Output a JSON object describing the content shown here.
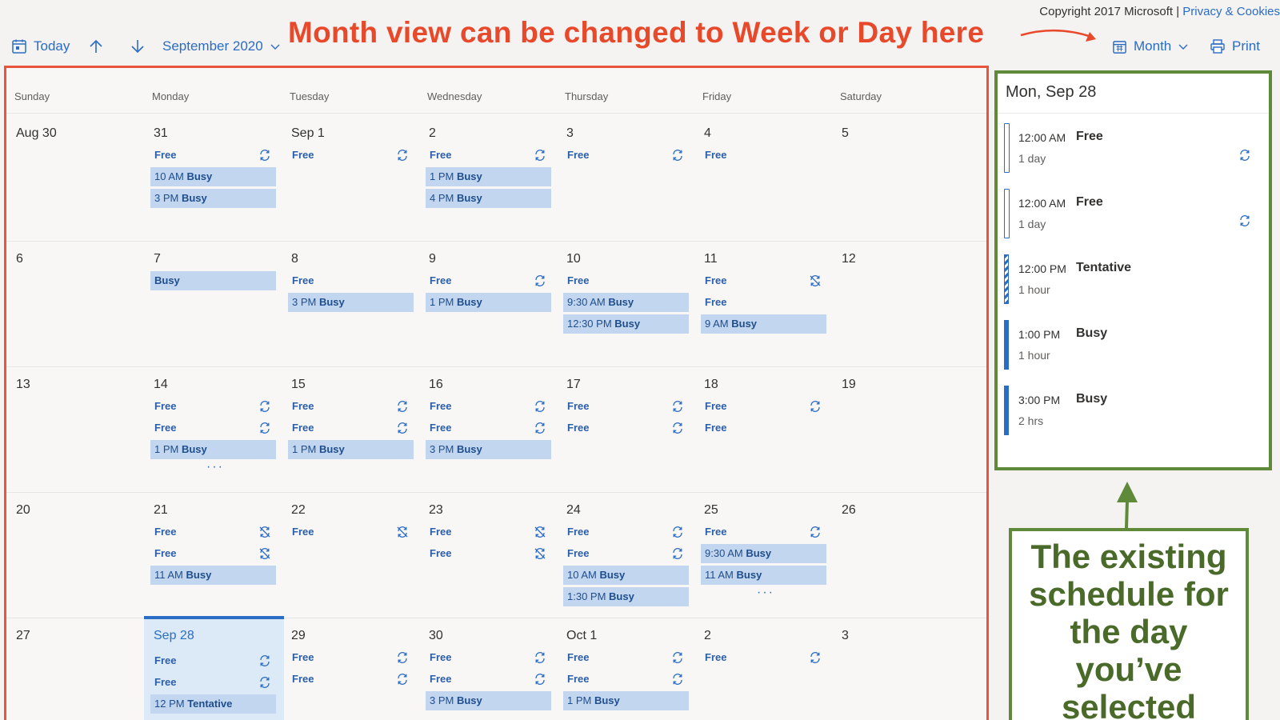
{
  "header": {
    "copyright": "Copyright 2017 Microsoft",
    "separator": "|",
    "privacy_link": "Privacy & Cookies"
  },
  "toolbar": {
    "today": "Today",
    "month_range": "September 2020",
    "view": "Month",
    "print": "Print"
  },
  "annotations": {
    "top": "Month view can be changed to Week or Day here",
    "side_lines": [
      "The existing",
      "schedule for",
      "the day",
      "you’ve",
      "selected"
    ],
    "red_color": "#e8492a",
    "green_color": "#5e8a3a"
  },
  "calendar": {
    "day_names": [
      "Sunday",
      "Monday",
      "Tuesday",
      "Wednesday",
      "Thursday",
      "Friday",
      "Saturday"
    ],
    "weeks": [
      [
        {
          "date": "Aug 30",
          "events": []
        },
        {
          "date": "31",
          "events": [
            {
              "status": "Free",
              "icon": "sync-icon"
            },
            {
              "time": "10 AM",
              "status": "Busy"
            },
            {
              "time": "3 PM",
              "status": "Busy"
            }
          ]
        },
        {
          "date": "Sep 1",
          "events": [
            {
              "status": "Free",
              "icon": "sync-icon"
            }
          ]
        },
        {
          "date": "2",
          "events": [
            {
              "status": "Free",
              "icon": "sync-icon"
            },
            {
              "time": "1 PM",
              "status": "Busy"
            },
            {
              "time": "4 PM",
              "status": "Busy"
            }
          ]
        },
        {
          "date": "3",
          "events": [
            {
              "status": "Free",
              "icon": "sync-icon"
            }
          ]
        },
        {
          "date": "4",
          "events": [
            {
              "status": "Free"
            }
          ]
        },
        {
          "date": "5",
          "events": []
        }
      ],
      [
        {
          "date": "6",
          "events": []
        },
        {
          "date": "7",
          "events": [
            {
              "status": "Busy"
            }
          ]
        },
        {
          "date": "8",
          "events": [
            {
              "status": "Free"
            },
            {
              "time": "3 PM",
              "status": "Busy"
            }
          ]
        },
        {
          "date": "9",
          "events": [
            {
              "status": "Free",
              "icon": "sync-icon"
            },
            {
              "time": "1 PM",
              "status": "Busy"
            }
          ]
        },
        {
          "date": "10",
          "events": [
            {
              "status": "Free"
            },
            {
              "time": "9:30 AM",
              "status": "Busy"
            },
            {
              "time": "12:30 PM",
              "status": "Busy"
            }
          ]
        },
        {
          "date": "11",
          "events": [
            {
              "status": "Free",
              "icon": "sync-off-icon"
            },
            {
              "status": "Free"
            },
            {
              "time": "9 AM",
              "status": "Busy"
            }
          ]
        },
        {
          "date": "12",
          "events": []
        }
      ],
      [
        {
          "date": "13",
          "events": []
        },
        {
          "date": "14",
          "more": "···",
          "events": [
            {
              "status": "Free",
              "icon": "sync-icon"
            },
            {
              "status": "Free",
              "icon": "sync-icon"
            },
            {
              "time": "1 PM",
              "status": "Busy"
            }
          ]
        },
        {
          "date": "15",
          "events": [
            {
              "status": "Free",
              "icon": "sync-icon"
            },
            {
              "status": "Free",
              "icon": "sync-icon"
            },
            {
              "time": "1 PM",
              "status": "Busy"
            }
          ]
        },
        {
          "date": "16",
          "events": [
            {
              "status": "Free",
              "icon": "sync-icon"
            },
            {
              "status": "Free",
              "icon": "sync-icon"
            },
            {
              "time": "3 PM",
              "status": "Busy"
            }
          ]
        },
        {
          "date": "17",
          "events": [
            {
              "status": "Free",
              "icon": "sync-icon"
            },
            {
              "status": "Free",
              "icon": "sync-icon"
            }
          ]
        },
        {
          "date": "18",
          "events": [
            {
              "status": "Free",
              "icon": "sync-icon"
            },
            {
              "status": "Free"
            }
          ]
        },
        {
          "date": "19",
          "events": []
        }
      ],
      [
        {
          "date": "20",
          "events": []
        },
        {
          "date": "21",
          "events": [
            {
              "status": "Free",
              "icon": "sync-off-icon"
            },
            {
              "status": "Free",
              "icon": "sync-off-icon"
            },
            {
              "time": "11 AM",
              "status": "Busy"
            }
          ]
        },
        {
          "date": "22",
          "events": [
            {
              "status": "Free",
              "icon": "sync-off-icon"
            }
          ]
        },
        {
          "date": "23",
          "events": [
            {
              "status": "Free",
              "icon": "sync-off-icon"
            },
            {
              "status": "Free",
              "icon": "sync-off-icon"
            }
          ]
        },
        {
          "date": "24",
          "events": [
            {
              "status": "Free",
              "icon": "sync-icon"
            },
            {
              "status": "Free",
              "icon": "sync-icon"
            },
            {
              "time": "10 AM",
              "status": "Busy"
            },
            {
              "time": "1:30 PM",
              "status": "Busy"
            }
          ]
        },
        {
          "date": "25",
          "more": "···",
          "events": [
            {
              "status": "Free",
              "icon": "sync-icon"
            },
            {
              "time": "9:30 AM",
              "status": "Busy"
            },
            {
              "time": "11 AM",
              "status": "Busy"
            }
          ]
        },
        {
          "date": "26",
          "events": []
        }
      ],
      [
        {
          "date": "27",
          "events": []
        },
        {
          "date": "Sep 28",
          "selected": true,
          "events": [
            {
              "status": "Free",
              "icon": "sync-icon"
            },
            {
              "status": "Free",
              "icon": "sync-icon"
            },
            {
              "time": "12 PM",
              "status": "Tentative"
            }
          ]
        },
        {
          "date": "29",
          "events": [
            {
              "status": "Free",
              "icon": "sync-icon"
            },
            {
              "status": "Free",
              "icon": "sync-icon"
            }
          ]
        },
        {
          "date": "30",
          "events": [
            {
              "status": "Free",
              "icon": "sync-icon"
            },
            {
              "status": "Free",
              "icon": "sync-icon"
            },
            {
              "time": "3 PM",
              "status": "Busy"
            }
          ]
        },
        {
          "date": "Oct 1",
          "events": [
            {
              "status": "Free",
              "icon": "sync-icon"
            },
            {
              "status": "Free",
              "icon": "sync-icon"
            },
            {
              "time": "1 PM",
              "status": "Busy"
            }
          ]
        },
        {
          "date": "2",
          "events": [
            {
              "status": "Free",
              "icon": "sync-icon"
            }
          ]
        },
        {
          "date": "3",
          "events": []
        }
      ]
    ]
  },
  "day_panel": {
    "title": "Mon, Sep 28",
    "items": [
      {
        "time": "12:00 AM",
        "status": "Free",
        "duration": "1 day",
        "kind": "free",
        "icon": "sync-icon"
      },
      {
        "time": "12:00 AM",
        "status": "Free",
        "duration": "1 day",
        "kind": "free",
        "icon": "sync-icon"
      },
      {
        "time": "12:00 PM",
        "status": "Tentative",
        "duration": "1 hour",
        "kind": "tentative"
      },
      {
        "time": "1:00 PM",
        "status": "Busy",
        "duration": "1 hour",
        "kind": "busy"
      },
      {
        "time": "3:00 PM",
        "status": "Busy",
        "duration": "2 hrs",
        "kind": "busy"
      }
    ]
  }
}
